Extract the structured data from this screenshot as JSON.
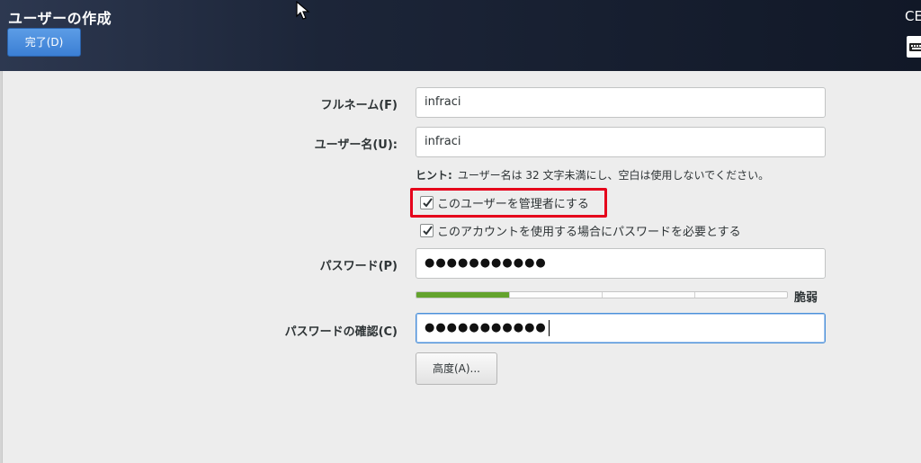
{
  "header": {
    "title": "ユーザーの作成",
    "done_label": "完了(D)",
    "right_text": "CE"
  },
  "form": {
    "fullname": {
      "label": "フルネーム(F)",
      "value": "infraci"
    },
    "username": {
      "label": "ユーザー名(U):",
      "value": "infraci"
    },
    "hint": {
      "label": "ヒント:",
      "text": "ユーザー名は 32 文字未満にし、空白は使用しないでください。"
    },
    "admin_checkbox": {
      "label": "このユーザーを管理者にする",
      "checked": true
    },
    "require_password_checkbox": {
      "label": "このアカウントを使用する場合にパスワードを必要とする",
      "checked": true
    },
    "password": {
      "label": "パスワード(P)",
      "value": "●●●●●●●●●●●"
    },
    "strength": {
      "label": "脆弱",
      "level": 0.25,
      "color": "#63a32d"
    },
    "confirm_password": {
      "label": "パスワードの確認(C)",
      "value": "●●●●●●●●●●●"
    },
    "advanced_label": "高度(A)..."
  },
  "icons": {
    "cursor": "mouse-pointer-icon",
    "keyboard": "keyboard-icon",
    "checkmark": "checkmark-icon"
  },
  "colors": {
    "header_bg": "#1c2538",
    "done_button": "#4a8fe0",
    "highlight": "#e5001b",
    "focus_border": "#4a90d9"
  }
}
